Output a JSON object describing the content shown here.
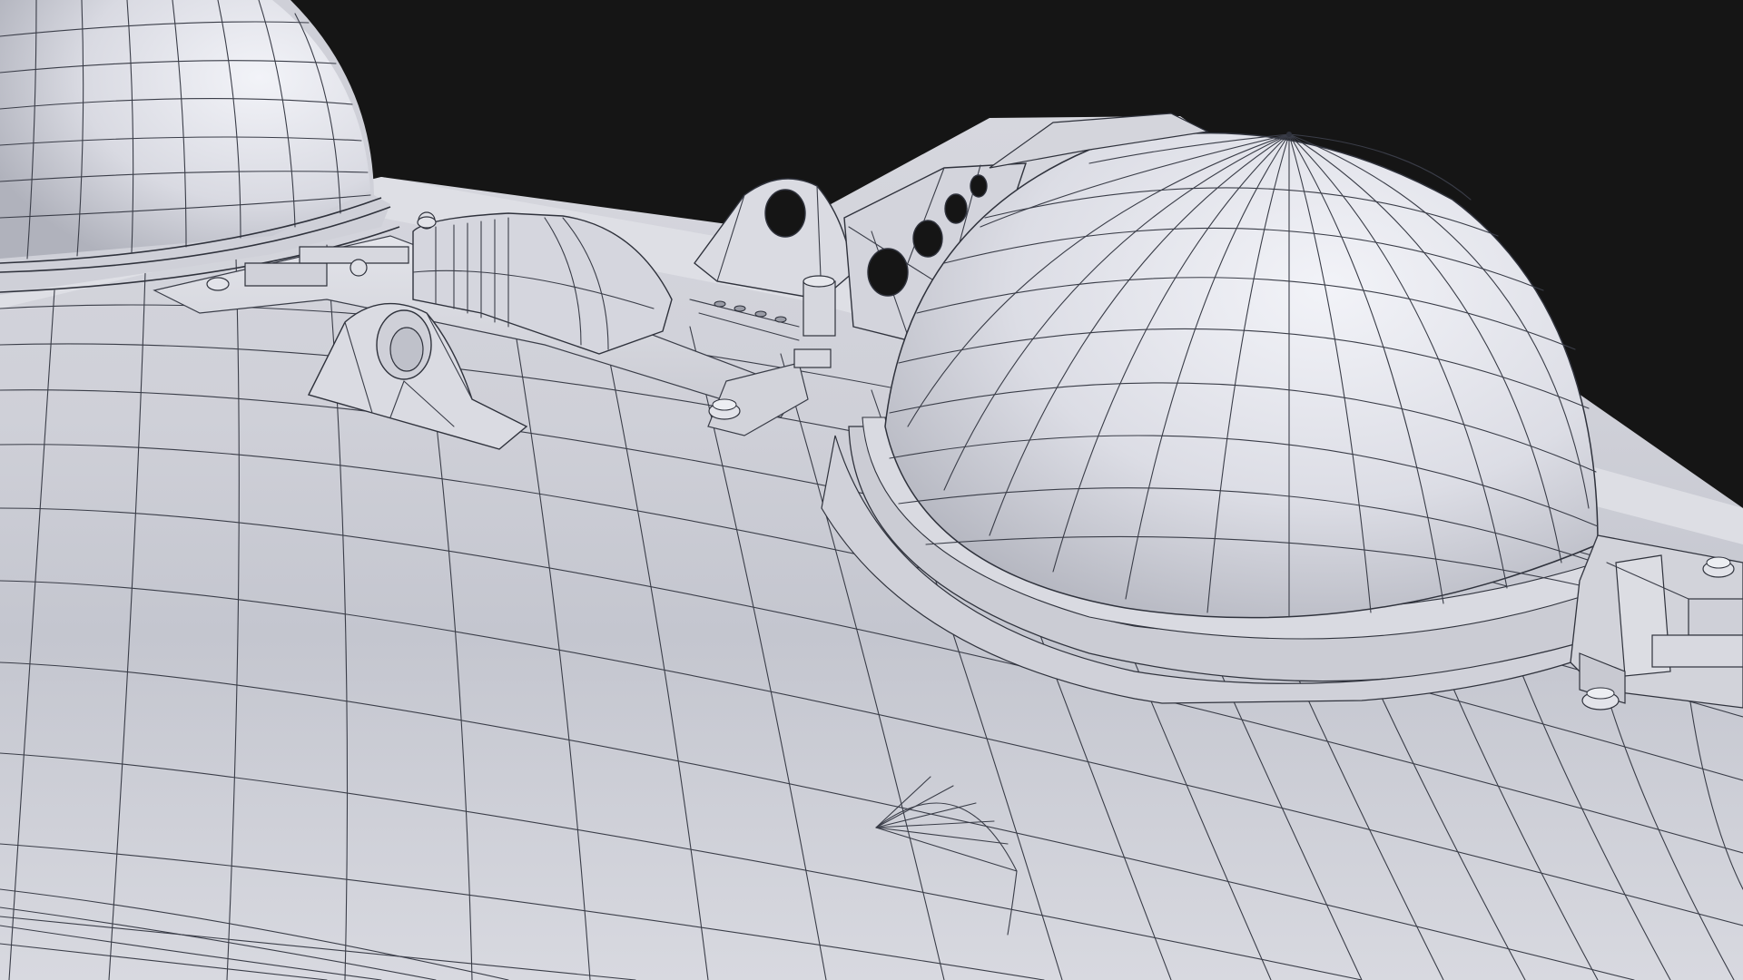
{
  "viewport": {
    "background_color": "#151515",
    "mesh_color": "#dcdde4",
    "mesh_shade_color": "#b4b6c0",
    "edge_color": "#3a3d48"
  },
  "objects": [
    {
      "name": "hull"
    },
    {
      "name": "left-dome"
    },
    {
      "name": "right-dome"
    },
    {
      "name": "turbine-housing"
    },
    {
      "name": "lifting-eye-left"
    },
    {
      "name": "lifting-eye-center"
    },
    {
      "name": "vent-panel"
    },
    {
      "name": "bolt"
    },
    {
      "name": "hinge-assembly-right"
    }
  ]
}
